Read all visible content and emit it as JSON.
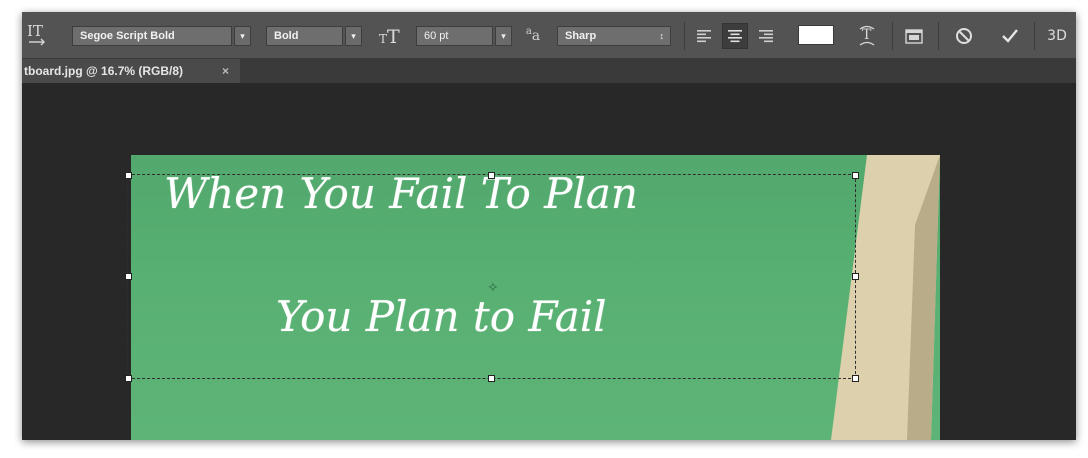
{
  "options_bar": {
    "tool_icon": "text-orientation-icon",
    "font_family": "Segoe Script Bold",
    "font_style": "Bold",
    "font_size_icon": "font-size-icon",
    "font_size": "60 pt",
    "anti_alias_icon": "anti-alias-icon",
    "anti_alias_label": "a",
    "anti_alias_label_sub": "a",
    "anti_alias": "Sharp",
    "text_color": "#ffffff",
    "three_d": "3D"
  },
  "document_tab": {
    "title": "tboard.jpg @ 16.7% (RGB/8)",
    "close": "×"
  },
  "canvas": {
    "line1": "When You Fail To Plan",
    "line2": "You Plan to Fail",
    "board_color": "#56ad70"
  }
}
